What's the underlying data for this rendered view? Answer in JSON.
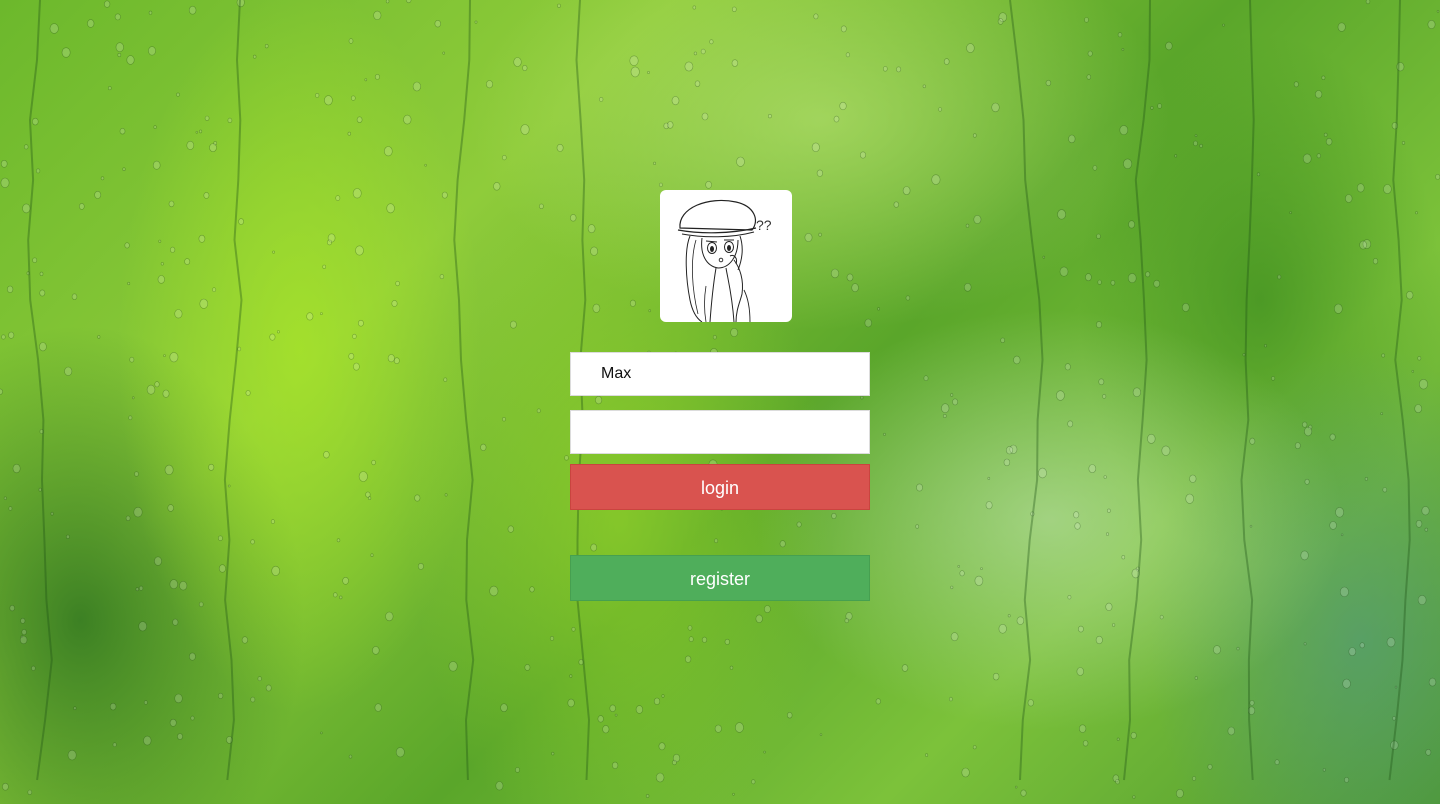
{
  "background": {
    "description_icon": "rain-on-glass-green-background"
  },
  "avatar": {
    "icon": "anime-girl-avatar",
    "question_marks": "??"
  },
  "form": {
    "username_value": "Max",
    "password_value": "",
    "login_label": "login",
    "register_label": "register"
  },
  "colors": {
    "login": "#d9534f",
    "register": "#4fae5b"
  }
}
